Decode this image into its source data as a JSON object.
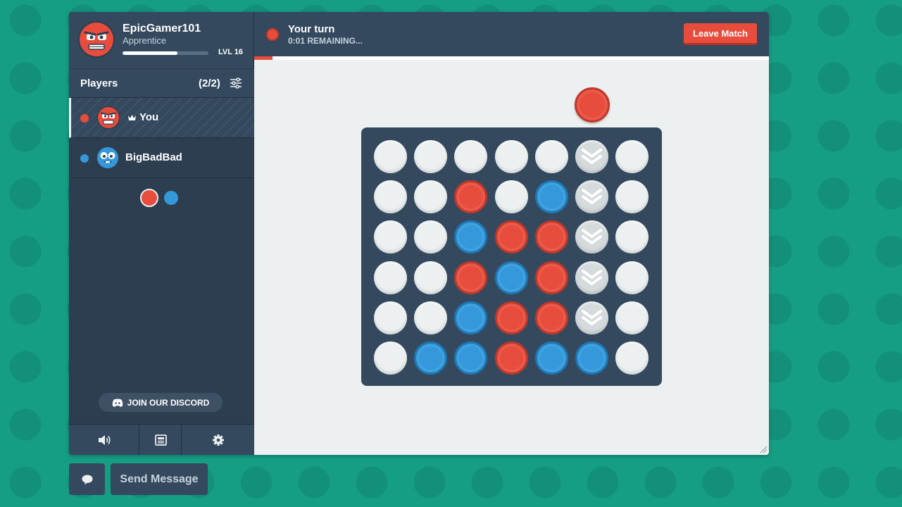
{
  "profile": {
    "username": "EpicGamer101",
    "rank": "Apprentice",
    "level_label": "LVL 16",
    "xp_progress": 0.64,
    "avatar_icon": "red-grumpy-face-avatar"
  },
  "players": {
    "title": "Players",
    "count": "(2/2)",
    "list": [
      {
        "name": "You",
        "color": "#e74c3c",
        "avatar_icon": "red-grumpy-face-avatar",
        "host": true
      },
      {
        "name": "BigBadBad",
        "color": "#3498db",
        "avatar_icon": "blue-goofy-face-avatar",
        "host": false
      }
    ]
  },
  "discord": {
    "label": "JOIN OUR DISCORD"
  },
  "footer": {
    "icons": [
      "volume-icon",
      "newspaper-icon",
      "gear-icon"
    ]
  },
  "game": {
    "turn_title": "Your turn",
    "timer": "0:01 REMAINING...",
    "timer_progress": 0.035,
    "leave_label": "Leave Match",
    "current_color": "#e74c3c",
    "hover_column": 5,
    "board": [
      [
        "E",
        "E",
        "E",
        "E",
        "E",
        "H",
        "E"
      ],
      [
        "E",
        "E",
        "R",
        "E",
        "B",
        "H",
        "E"
      ],
      [
        "E",
        "E",
        "B",
        "R",
        "R",
        "H",
        "E"
      ],
      [
        "E",
        "E",
        "R",
        "B",
        "R",
        "H",
        "E"
      ],
      [
        "E",
        "E",
        "B",
        "R",
        "R",
        "H",
        "E"
      ],
      [
        "E",
        "B",
        "B",
        "R",
        "B",
        "B",
        "E"
      ]
    ]
  },
  "chat": {
    "send_label": "Send Message"
  },
  "colors": {
    "red": "#e74c3c",
    "blue": "#3498db",
    "panel": "#34495e",
    "background": "#169e85"
  }
}
